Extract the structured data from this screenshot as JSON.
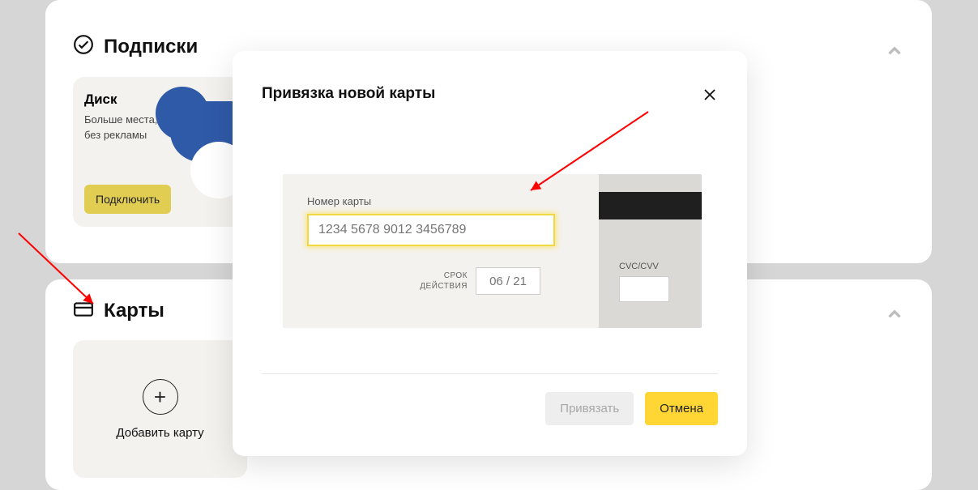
{
  "subscriptions": {
    "title": "Подписки",
    "disk": {
      "name": "Диск",
      "desc_l1": "Больше места,",
      "desc_l2": "без рекламы",
      "connect": "Подключить"
    }
  },
  "cards_section": {
    "title": "Карты",
    "add_label": "Добавить карту"
  },
  "modal": {
    "title": "Привязка новой карты",
    "card_number_label": "Номер карты",
    "card_number_placeholder": "1234 5678 9012 3456789",
    "card_number_value": "",
    "expiry_label_l1": "СРОК",
    "expiry_label_l2": "ДЕЙСТВИЯ",
    "expiry_placeholder": "06 / 21",
    "expiry_value": "",
    "cvc_label": "CVC/CVV",
    "cvc_value": "",
    "bind": "Привязать",
    "cancel": "Отмена"
  }
}
